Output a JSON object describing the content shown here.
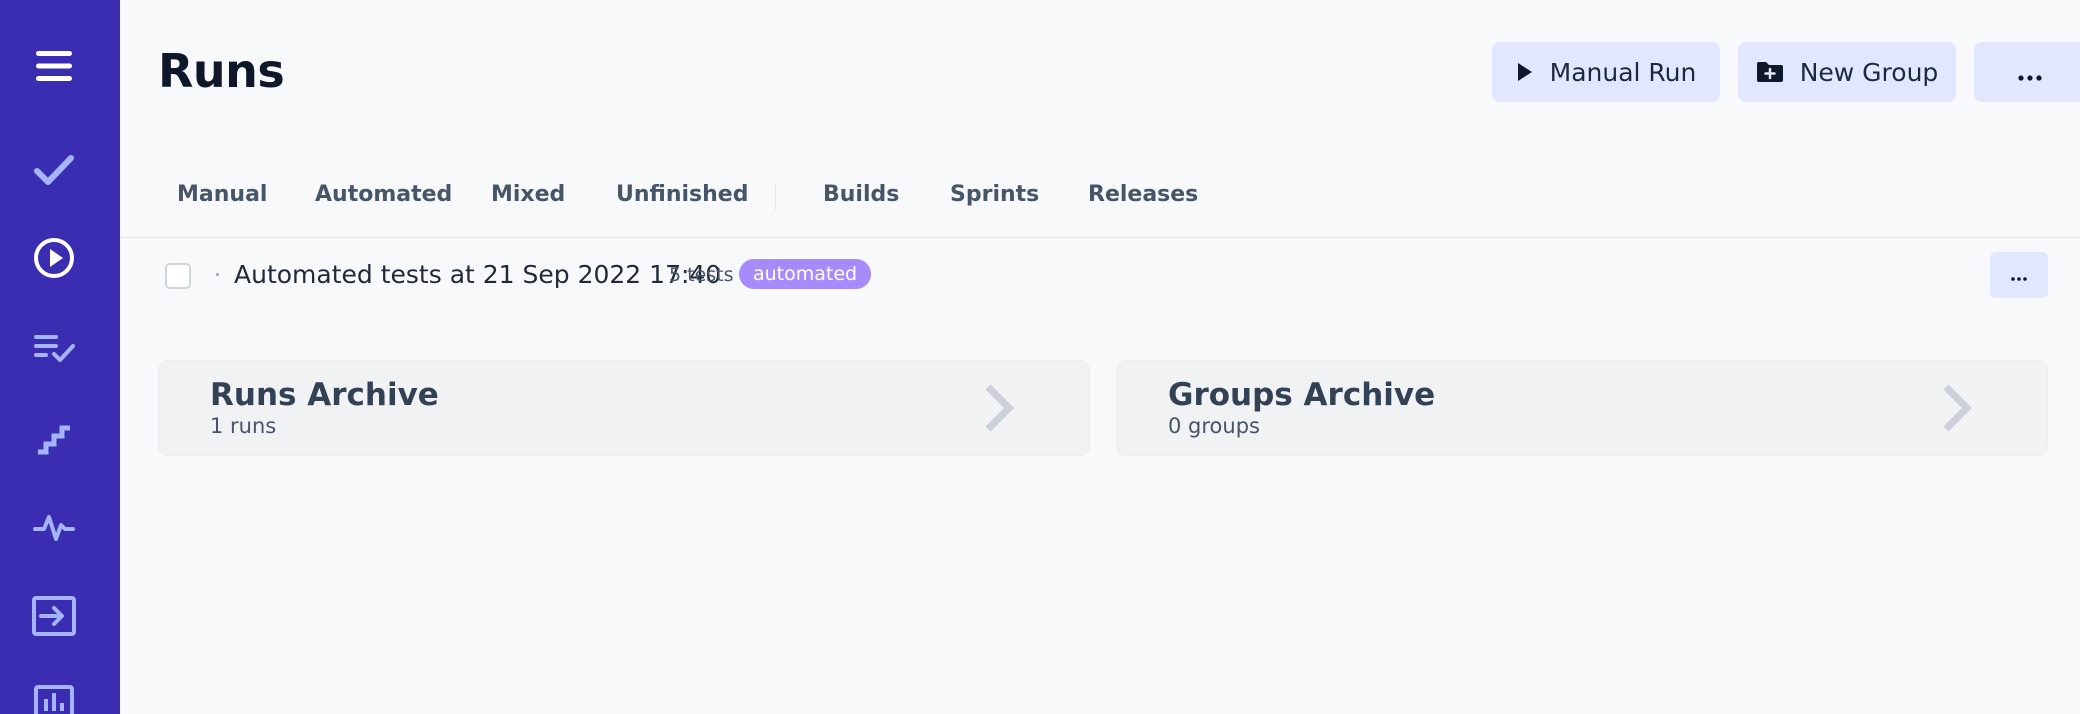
{
  "page": {
    "title": "Runs"
  },
  "header": {
    "manual_run_label": "Manual Run",
    "new_group_label": "New Group",
    "more_label": "···"
  },
  "sidebar": {
    "items": [
      {
        "icon": "menu-icon"
      },
      {
        "icon": "checkmark-icon"
      },
      {
        "icon": "play-circle-icon"
      },
      {
        "icon": "checklist-icon"
      },
      {
        "icon": "steps-icon"
      },
      {
        "icon": "pulse-icon"
      },
      {
        "icon": "import-icon"
      },
      {
        "icon": "bar-chart-icon"
      }
    ]
  },
  "tabs": [
    {
      "label": "Manual"
    },
    {
      "label": "Automated"
    },
    {
      "label": "Mixed"
    },
    {
      "label": "Unfinished"
    },
    {
      "label": "Builds"
    },
    {
      "label": "Sprints"
    },
    {
      "label": "Releases"
    }
  ],
  "runs": [
    {
      "title": "Automated tests at 21 Sep 2022 17:40",
      "count": "5 tests",
      "badge": "automated",
      "more_label": "···"
    }
  ],
  "archives": {
    "runs": {
      "title": "Runs Archive",
      "subtitle": "1 runs"
    },
    "groups": {
      "title": "Groups Archive",
      "subtitle": "0 groups"
    }
  },
  "colors": {
    "sidebar": "#3b2db2",
    "sidebar_icon": "#a5b4fc",
    "button_bg": "#e0e7ff",
    "badge_bg": "#a78bfa",
    "page_bg": "#f8f9fb"
  }
}
